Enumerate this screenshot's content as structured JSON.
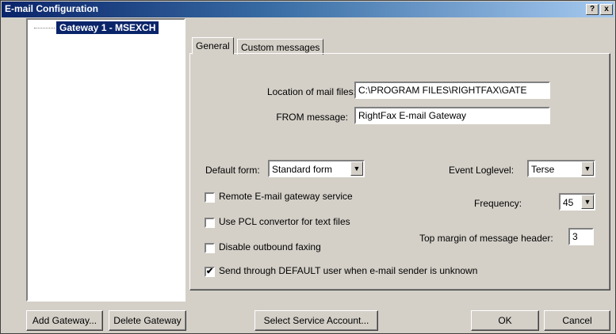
{
  "window": {
    "title": "E-mail Configuration",
    "help_button": "?",
    "close_button": "x"
  },
  "tree": {
    "items": [
      {
        "label": "Gateway 1 - MSEXCH",
        "selected": true
      }
    ]
  },
  "tabs": [
    {
      "label": "General",
      "active": true
    },
    {
      "label": "Custom messages",
      "active": false
    }
  ],
  "general": {
    "mail_location_label": "Location of mail files:",
    "mail_location_value": "C:\\PROGRAM FILES\\RIGHTFAX\\GATE",
    "from_message_label": "FROM message:",
    "from_message_value": "RightFax E-mail Gateway",
    "default_form_label": "Default form:",
    "default_form_value": "Standard form",
    "event_loglevel_label": "Event Loglevel:",
    "event_loglevel_value": "Terse",
    "frequency_label": "Frequency:",
    "frequency_value": "45",
    "top_margin_label": "Top margin of message header:",
    "top_margin_value": "3",
    "checkboxes": [
      {
        "label": "Remote E-mail gateway service",
        "checked": false
      },
      {
        "label": "Use PCL convertor for text files",
        "checked": false
      },
      {
        "label": "Disable outbound faxing",
        "checked": false
      },
      {
        "label": "Send through DEFAULT user when e-mail sender is unknown",
        "checked": true
      }
    ]
  },
  "buttons": {
    "add_gateway": "Add Gateway...",
    "delete_gateway": "Delete Gateway",
    "select_service_account": "Select Service Account...",
    "ok": "OK",
    "cancel": "Cancel"
  },
  "icons": {
    "dropdown_arrow": "▼",
    "check_mark": "✔"
  },
  "colors": {
    "titlebar_start": "#0a246a",
    "titlebar_end": "#a6caf0",
    "face": "#d4d0c8",
    "selection": "#0a246a"
  }
}
